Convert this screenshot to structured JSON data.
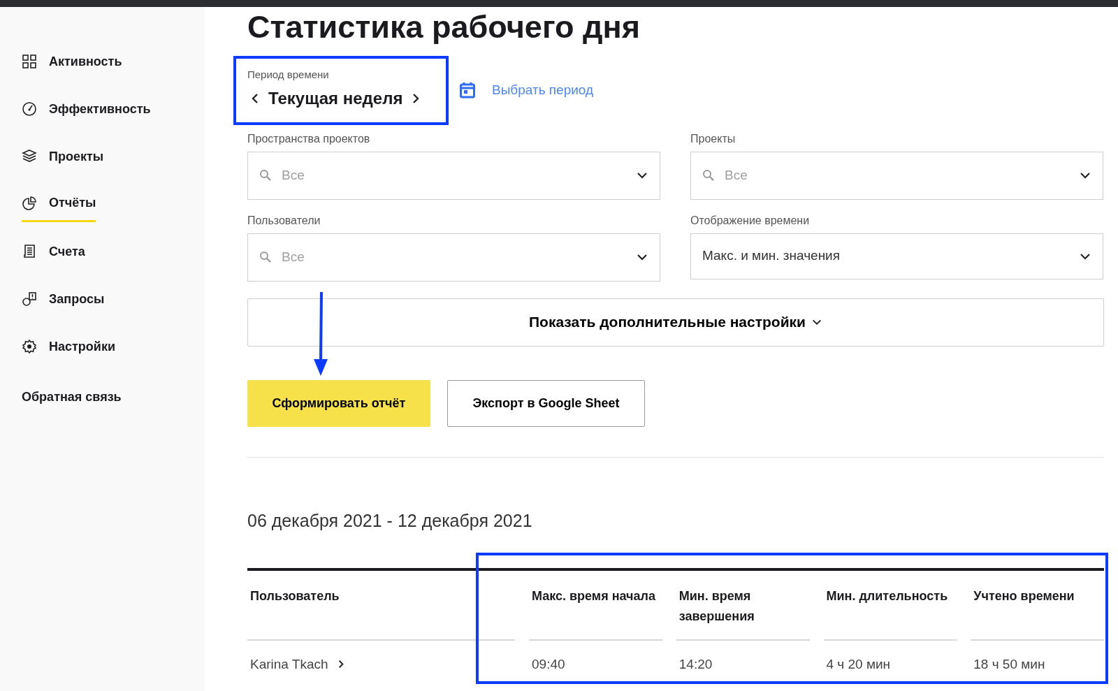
{
  "sidebar": {
    "items": [
      {
        "label": "Активность",
        "selected": false
      },
      {
        "label": "Эффективность",
        "selected": false
      },
      {
        "label": "Проекты",
        "selected": false
      },
      {
        "label": "Отчёты",
        "selected": true
      },
      {
        "label": "Счета",
        "selected": false
      },
      {
        "label": "Запросы",
        "selected": false
      },
      {
        "label": "Настройки",
        "selected": false
      },
      {
        "label": "Обратная связь",
        "selected": false
      }
    ]
  },
  "title": "Статистика рабочего дня",
  "period": {
    "label": "Период времени",
    "value": "Текущая неделя",
    "highlighted": true,
    "pick_link": "Выбрать период"
  },
  "filters": [
    {
      "label": "Пространства проектов",
      "kind": "search",
      "placeholder": "Все"
    },
    {
      "label": "Проекты",
      "kind": "search",
      "placeholder": "Все"
    },
    {
      "label": "Пользователи",
      "kind": "search",
      "placeholder": "Все"
    },
    {
      "label": "Отображение времени",
      "kind": "select",
      "value": "Макс. и мин. значения"
    }
  ],
  "more_settings": "Показать дополнительные настройки",
  "actions": [
    {
      "label": "Сформировать отчёт",
      "kind": "primary",
      "arrow_marked": true
    },
    {
      "label": "Экспорт в Google Sheet",
      "kind": "outline"
    }
  ],
  "date_range": "06 декабря 2021 - 12 декабря 2021",
  "table": {
    "header_highlighted": true,
    "columns": [
      "Пользователь",
      "Макс. время начала",
      "Мин. время завершения",
      "Мин. длительность",
      "Учтено времени"
    ],
    "rows": [
      [
        "Karina Tkach",
        "09:40",
        "14:20",
        "4 ч 20 мин",
        "18 ч 50 мин"
      ]
    ]
  }
}
